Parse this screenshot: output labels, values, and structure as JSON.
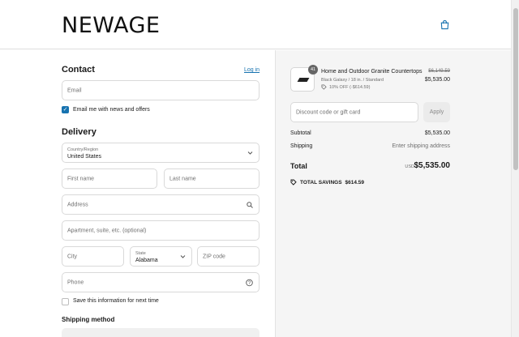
{
  "brand": {
    "logo_text": "NEWAGE"
  },
  "contact": {
    "title": "Contact",
    "login_label": "Log in",
    "email_placeholder": "Email",
    "newsletter_label": "Email me with news and offers"
  },
  "delivery": {
    "title": "Delivery",
    "country_label": "Country/Region",
    "country_value": "United States",
    "first_name_placeholder": "First name",
    "last_name_placeholder": "Last name",
    "address_placeholder": "Address",
    "apartment_placeholder": "Apartment, suite, etc. (optional)",
    "city_placeholder": "City",
    "state_label": "State",
    "state_value": "Alabama",
    "zip_placeholder": "ZIP code",
    "phone_placeholder": "Phone",
    "save_info_label": "Save this information for next time",
    "shipping_method_title": "Shipping method"
  },
  "summary": {
    "product": {
      "quantity": "41",
      "name": "Home and Outdoor Granite Countertops",
      "variant": "Black Galaxy / 18 in. / Standard",
      "discount": "10% OFF (-$614.59)",
      "old_price": "$6,149.59",
      "price": "$5,535.00"
    },
    "discount_placeholder": "Discount code or gift card",
    "apply_label": "Apply",
    "subtotal_label": "Subtotal",
    "subtotal_value": "$5,535.00",
    "shipping_label": "Shipping",
    "shipping_value": "Enter shipping address",
    "total_label": "Total",
    "currency": "USD",
    "total_value": "$5,535.00",
    "savings_label": "TOTAL SAVINGS",
    "savings_value": "$614.59"
  },
  "colors": {
    "accent": "#1773b0",
    "panel": "#f5f5f5"
  }
}
